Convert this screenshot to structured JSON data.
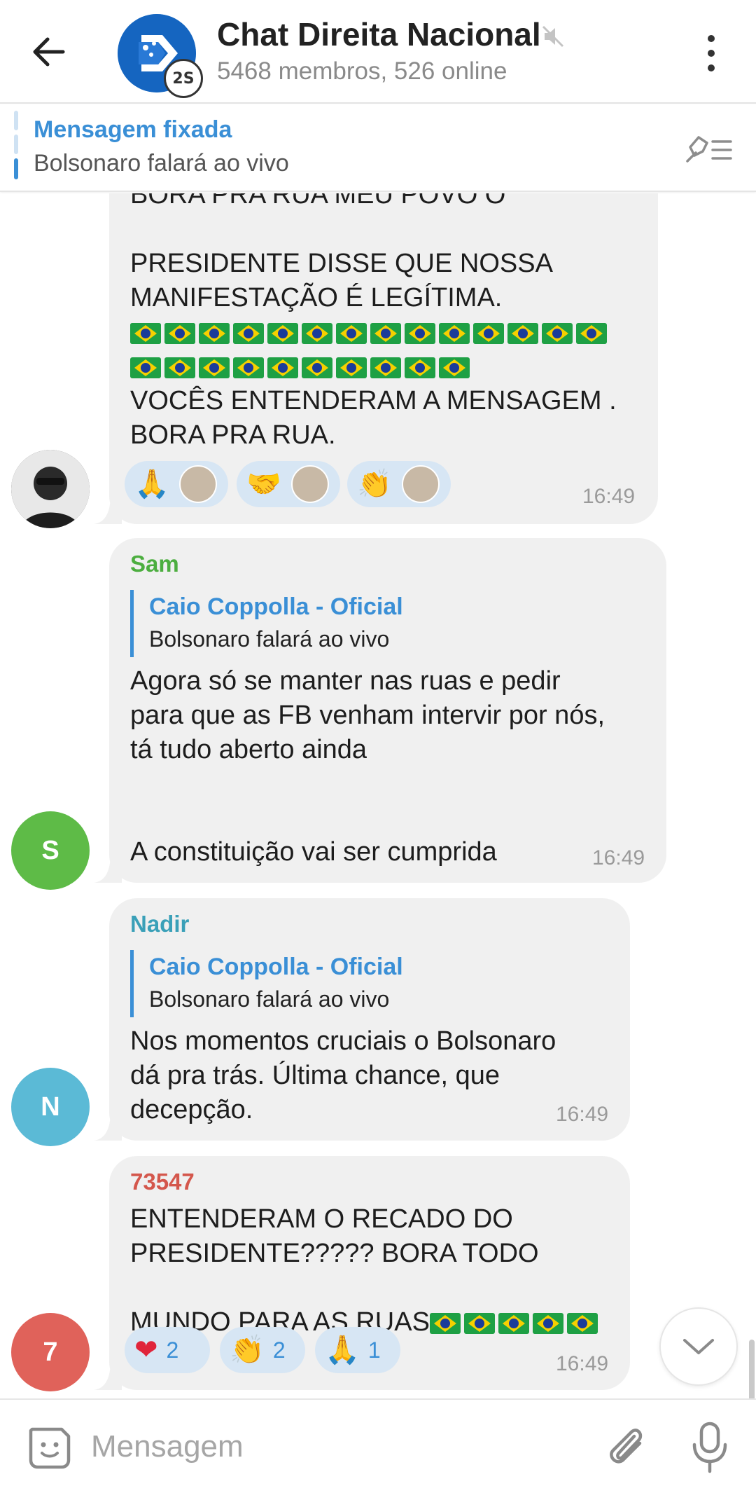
{
  "header": {
    "title": "Chat Direita Nacional",
    "subtitle": "5468 membros, 526 online",
    "badge": "2S"
  },
  "pinned": {
    "title": "Mensagem fixada",
    "text": "Bolsonaro falará ao vivo"
  },
  "messages": [
    {
      "text_top": "BORA PRA RUA MEU POVO O",
      "text_line2": "PRESIDENTE DISSE QUE NOSSA",
      "text_line3": "MANIFESTAÇÃO É LEGÍTIMA.",
      "text_bottom_1": "VOCÊS ENTENDERAM A MENSAGEM .",
      "text_bottom_2": "BORA PRA RUA.",
      "reactions": [
        {
          "emoji": "🙏"
        },
        {
          "emoji": "🤝"
        },
        {
          "emoji": "👏"
        }
      ],
      "time": "16:49"
    },
    {
      "sender": "Sam",
      "reply_name": "Caio Coppolla - Oficial",
      "reply_text": "Bolsonaro falará ao vivo",
      "text_1": "Agora só se manter nas ruas e pedir",
      "text_2": "para que as FB venham intervir por nós,",
      "text_3": "tá tudo aberto ainda",
      "text_4": "A constituição vai ser cumprida",
      "time": "16:49",
      "avatar_letter": "S"
    },
    {
      "sender": "Nadir",
      "reply_name": "Caio Coppolla - Oficial",
      "reply_text": "Bolsonaro falará ao vivo",
      "text_1": "Nos momentos cruciais o Bolsonaro",
      "text_2": "dá pra trás. Última chance, que",
      "text_3": "decepção.",
      "time": "16:49",
      "avatar_letter": "N"
    },
    {
      "sender": "73547",
      "text_1": "ENTENDERAM O RECADO DO",
      "text_2": "PRESIDENTE????? BORA TODO",
      "text_3": "MUNDO PARA AS RUAS",
      "reactions": [
        {
          "emoji": "❤",
          "count": "2"
        },
        {
          "emoji": "👏",
          "count": "2"
        },
        {
          "emoji": "🙏",
          "count": "1"
        }
      ],
      "time": "16:49",
      "avatar_letter": "7"
    }
  ],
  "input": {
    "placeholder": "Mensagem"
  },
  "colors": {
    "sam": "#4cae3f",
    "nadir": "#3aa0b8",
    "user73547": "#d4574c",
    "accent": "#3a8fd6",
    "bubble": "#f0f0f0"
  }
}
